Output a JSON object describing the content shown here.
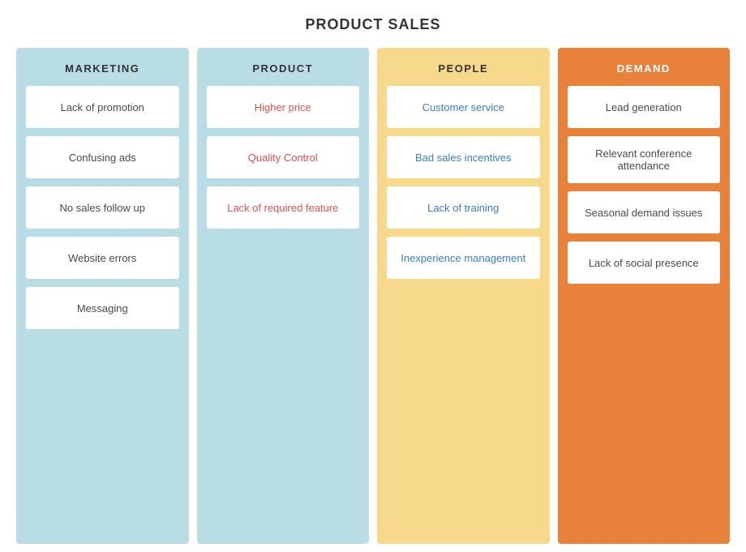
{
  "title": "PRODUCT SALES",
  "columns": [
    {
      "id": "marketing",
      "header": "MARKETING",
      "bgClass": "column-marketing",
      "cards": [
        {
          "text": "Lack of promotion",
          "colorClass": ""
        },
        {
          "text": "Confusing ads",
          "colorClass": ""
        },
        {
          "text": "No sales follow up",
          "colorClass": ""
        },
        {
          "text": "Website errors",
          "colorClass": ""
        },
        {
          "text": "Messaging",
          "colorClass": ""
        }
      ]
    },
    {
      "id": "product",
      "header": "PRODUCT",
      "bgClass": "column-product",
      "cards": [
        {
          "text": "Higher price",
          "colorClass": "card-red"
        },
        {
          "text": "Quality Control",
          "colorClass": "card-red"
        },
        {
          "text": "Lack of required feature",
          "colorClass": "card-red"
        }
      ]
    },
    {
      "id": "people",
      "header": "PEOPLE",
      "bgClass": "column-people",
      "cards": [
        {
          "text": "Customer service",
          "colorClass": "card-blue"
        },
        {
          "text": "Bad sales incentives",
          "colorClass": "card-blue"
        },
        {
          "text": "Lack of training",
          "colorClass": "card-blue"
        },
        {
          "text": "Inexperience management",
          "colorClass": "card-blue"
        }
      ]
    },
    {
      "id": "demand",
      "header": "DEMAND",
      "bgClass": "column-demand",
      "cards": [
        {
          "text": "Lead generation",
          "colorClass": ""
        },
        {
          "text": "Relevant conference attendance",
          "colorClass": ""
        },
        {
          "text": "Seasonal demand issues",
          "colorClass": ""
        },
        {
          "text": "Lack of social presence",
          "colorClass": ""
        }
      ]
    }
  ]
}
